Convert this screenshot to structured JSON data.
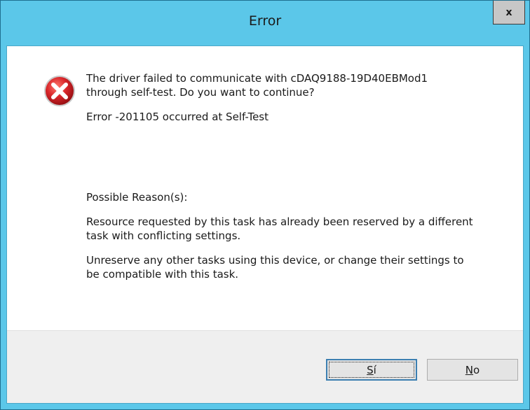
{
  "window": {
    "title": "Error",
    "close_label": "x"
  },
  "icon": {
    "name": "error-icon",
    "color": "#d9262a"
  },
  "message": {
    "line1": "The driver failed to communicate with cDAQ9188-19D40EBMod1",
    "line2": "through self-test.   Do you want to continue?",
    "error_line": "Error -201105 occurred at Self-Test",
    "reasons_heading": "Possible Reason(s):",
    "reason1_line1": "Resource requested by this task has already been reserved by a different",
    "reason1_line2": "task with conflicting settings.",
    "reason2_line1": "Unreserve any other tasks using this device, or change their settings to",
    "reason2_line2": "be compatible with this task."
  },
  "buttons": {
    "yes_mnemonic": "S",
    "yes_rest": "í",
    "no_mnemonic": "N",
    "no_rest": "o"
  },
  "colors": {
    "titlebar": "#5bc7e9",
    "footer": "#efefef"
  }
}
